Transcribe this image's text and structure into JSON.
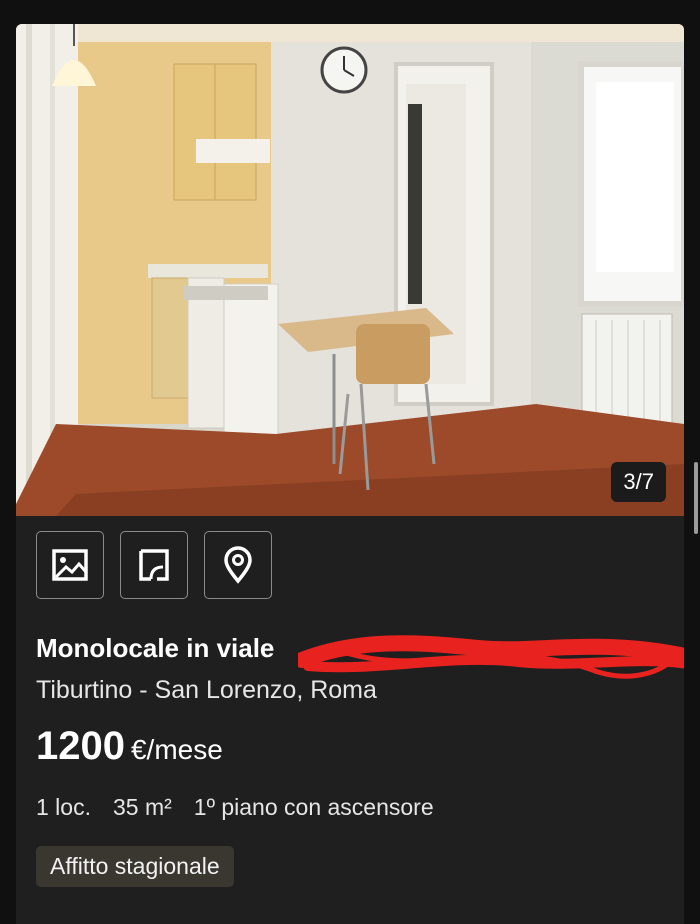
{
  "listing": {
    "photo_counter": "3/7",
    "title": "Monolocale in viale",
    "location": "Tiburtino - San Lorenzo, Roma",
    "price": "1200",
    "price_unit": "€/mese",
    "features": [
      "1 loc.",
      "35 m²",
      "1º piano con ascensore"
    ],
    "tag": "Affitto stagionale"
  },
  "actions": [
    {
      "icon": "image-icon"
    },
    {
      "icon": "floorplan-icon"
    },
    {
      "icon": "map-pin-icon"
    }
  ],
  "colors": {
    "background": "#101010",
    "card": "#1f1f1f",
    "tag_background": "#3a3731",
    "redaction": "#e8231f"
  }
}
